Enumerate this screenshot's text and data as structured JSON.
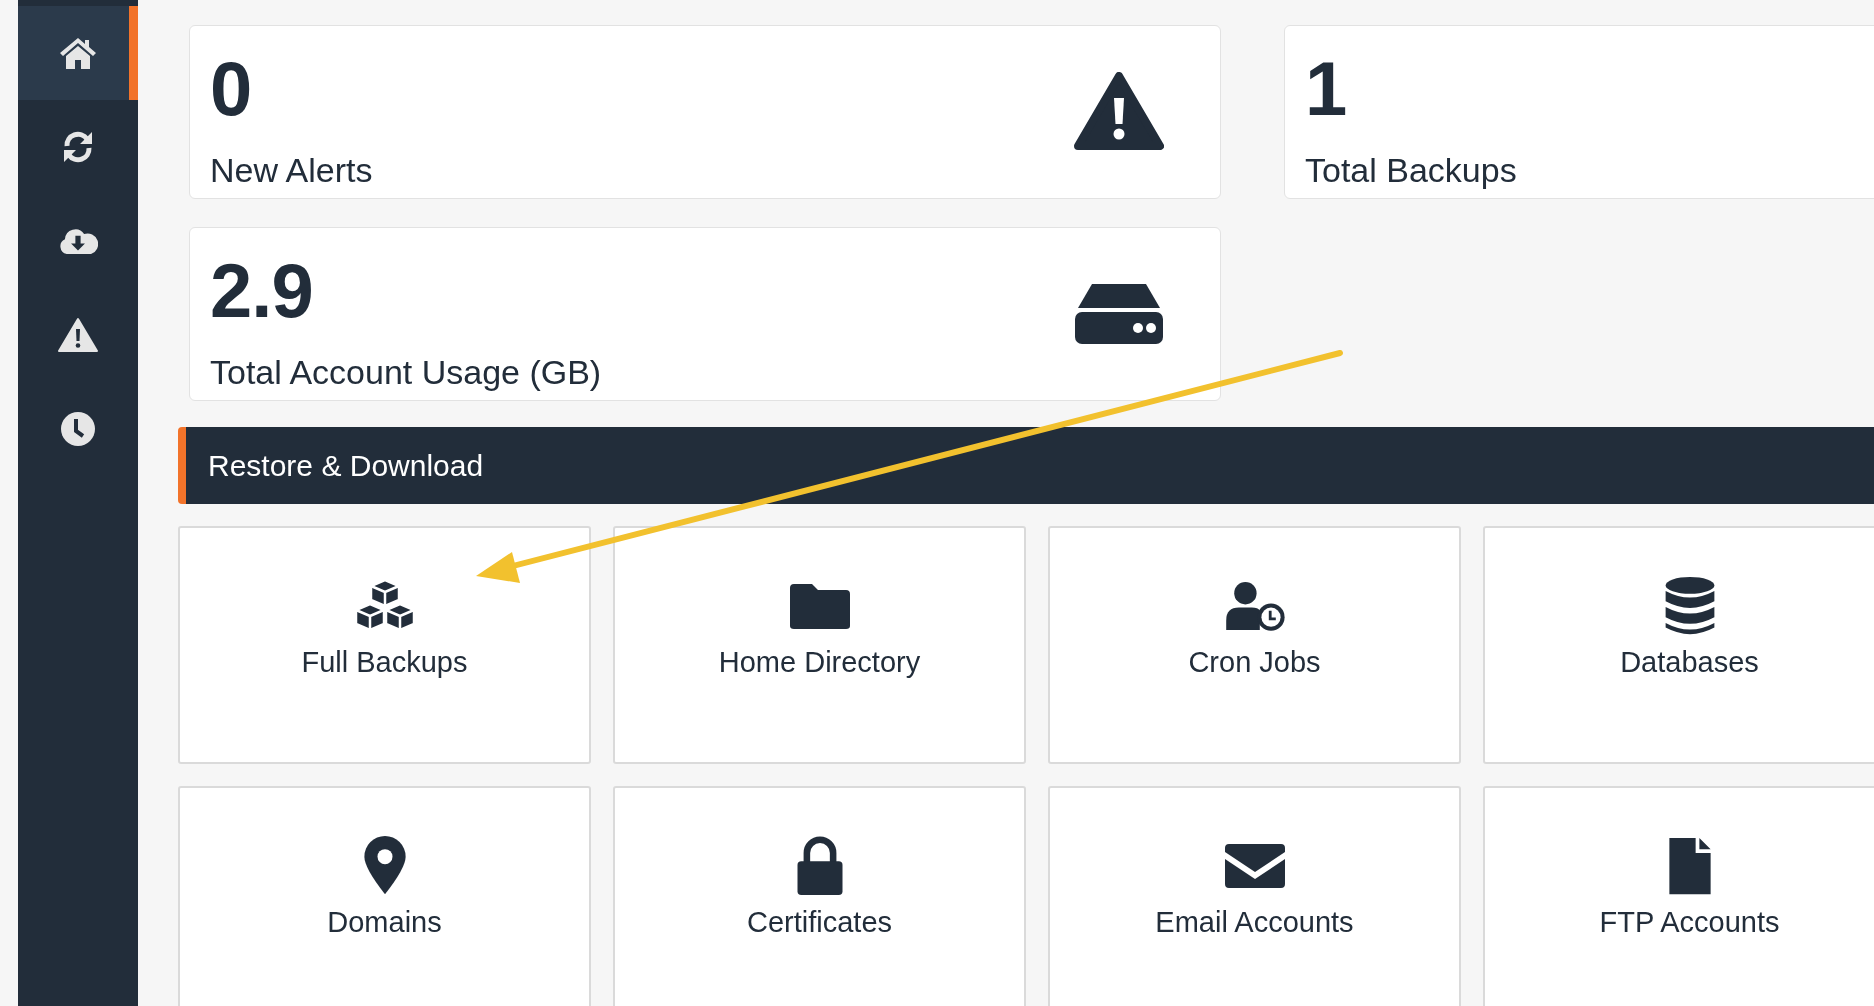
{
  "sidebar": {
    "items": [
      {
        "kind": "home",
        "selected": true
      },
      {
        "kind": "sync",
        "selected": false
      },
      {
        "kind": "cloud-download",
        "selected": false
      },
      {
        "kind": "warning",
        "selected": false
      },
      {
        "kind": "clock",
        "selected": false
      }
    ]
  },
  "stats": [
    {
      "value": "0",
      "label": "New Alerts",
      "kind": "warning"
    },
    {
      "value": "1",
      "label": "Total Backups",
      "kind": "plain"
    },
    {
      "value": "2.9",
      "label": "Total Account Usage (GB)",
      "kind": "drive"
    }
  ],
  "section": {
    "title": "Restore & Download"
  },
  "tiles": [
    {
      "label": "Full Backups",
      "kind": "cubes"
    },
    {
      "label": "Home Directory",
      "kind": "folder"
    },
    {
      "label": "Cron Jobs",
      "kind": "user-clock"
    },
    {
      "label": "Databases",
      "kind": "database"
    },
    {
      "label": "Domains",
      "kind": "pin"
    },
    {
      "label": "Certificates",
      "kind": "lock"
    },
    {
      "label": "Email Accounts",
      "kind": "envelope"
    },
    {
      "label": "FTP Accounts",
      "kind": "file"
    }
  ]
}
